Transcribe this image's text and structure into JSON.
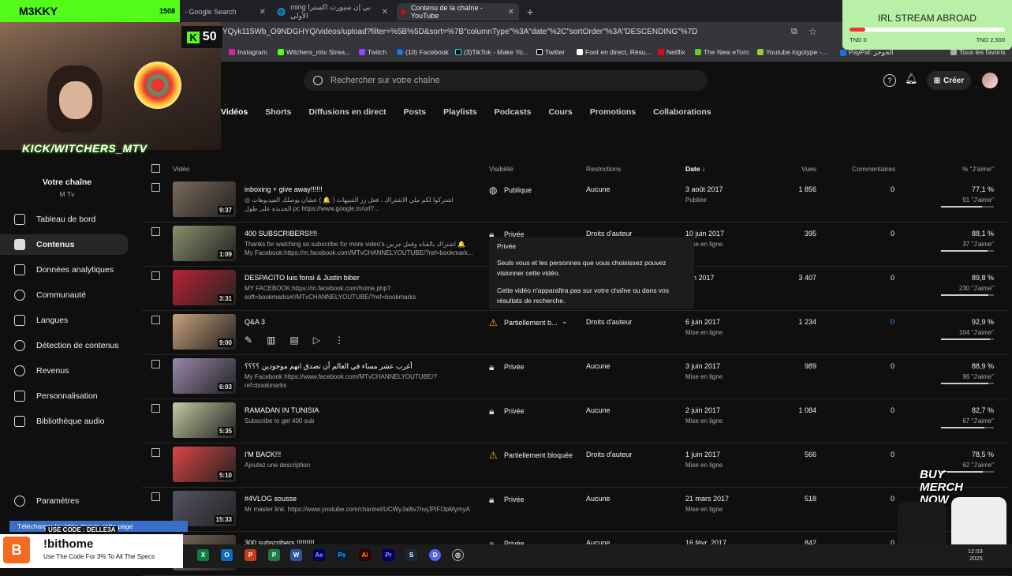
{
  "overlay": {
    "kick_username": "M3KKY",
    "kick_counter": "1508",
    "kick_badge_count": "50",
    "kick_handle": "KICK/WITCHERS_MTV",
    "stream_title": "IRL STREAM ABROAD",
    "stream_min": "TND 0",
    "stream_max": "TND 2,500",
    "stream_progress": 0.1,
    "merch_text": "BUY MERCH NOW",
    "promo_code": "USE CODE : DELLE3A",
    "promo_title": "!bithome",
    "promo_sub": "Use The Code For 3% To All The Specs",
    "download_text": "Télécharger la vidéo depuis cette page"
  },
  "browser": {
    "tabs": [
      {
        "label": "- Google Search"
      },
      {
        "label": "ming بي إن سبورت اكسترا الأولى"
      },
      {
        "label": "Contenu de la chaîne - YouTube"
      }
    ],
    "url": "YQyk115Wb_O9NDGHYQ/videos/upload?filter=%5B%5D&sort=%7B\"columnType\"%3A\"date\"%2C\"sortOrder\"%3A\"DESCENDING\"%7D",
    "bookmarks": [
      "Instagram",
      "Witchers_mtv Strea...",
      "Twitch",
      "(10) Facebook",
      "(3)TikTok - Make Yo...",
      "Twitter",
      "Foot en direct, Résu...",
      "Netflix",
      "The New eToro",
      "Youtube logotype -...",
      "PayPal: الجوجز",
      "Tous les favoris"
    ]
  },
  "header": {
    "search_placeholder": "Rechercher sur votre chaîne",
    "create_label": "Créer"
  },
  "content_tabs": [
    "Vidéos",
    "Shorts",
    "Diffusions en direct",
    "Posts",
    "Playlists",
    "Podcasts",
    "Cours",
    "Promotions",
    "Collaborations"
  ],
  "sidebar": {
    "channel_title": "Votre chaîne",
    "channel_name": "M Tv",
    "items": [
      {
        "label": "Tableau de bord"
      },
      {
        "label": "Contenus"
      },
      {
        "label": "Données analytiques"
      },
      {
        "label": "Communauté"
      },
      {
        "label": "Langues"
      },
      {
        "label": "Détection de contenus"
      },
      {
        "label": "Revenus"
      },
      {
        "label": "Personnalisation"
      },
      {
        "label": "Bibliothèque audio"
      }
    ],
    "settings_label": "Paramètres"
  },
  "table": {
    "headers": {
      "video": "Vidéo",
      "visibility": "Visibilité",
      "restrictions": "Restrictions",
      "date": "Date",
      "views": "Vues",
      "comments": "Commentaires",
      "likes": "% \"J'aime\""
    },
    "rows": [
      {
        "title": "inboxing + give away!!!!!!",
        "desc": "◎ اشتركوا لكم ملي الاشتراك ، فعل زر التنبيهات ( 🔔 ) عشان يوصلك الفيديوهات الجديده على طول pc https://www.google.tn/url?...",
        "duration": "9:37",
        "visibility": "Publique",
        "restriction": "Aucune",
        "date": "3 août 2017",
        "status": "Publiée",
        "views": "1 856",
        "comments": "0",
        "likes": "77,1 %",
        "like_count": "91 \"J'aime\"",
        "like_frac": 0.771
      },
      {
        "title": "400 SUBSCRIBERS!!!!",
        "desc": "Thanks for watching so subscribe for more video's اشتراك بالقناه وفعل جرس 🔔 My Facebook:https://m.facebook.com/MTvCHANNELYOUTUBE/?ref=bookmark...",
        "duration": "1:09",
        "visibility": "Privée",
        "restriction": "Droits d'auteur",
        "date": "10 juin 2017",
        "status": "Mise en ligne",
        "views": "395",
        "comments": "0",
        "likes": "88,1 %",
        "like_count": "37 \"J'aime\"",
        "like_frac": 0.881
      },
      {
        "title": "DESPACITO luis fonsi & Justin biber",
        "desc": "MY FACEBOOK:https://m.facebook.com/home.php?soft=bookmarks#!/MTvCHANNELYOUTUBE/?ref=bookmarks",
        "duration": "3:31",
        "visibility": "",
        "restriction": "",
        "date": "juin 2017",
        "status": "",
        "views": "3 407",
        "comments": "0",
        "likes": "89,8 %",
        "like_count": "230 \"J'aime\"",
        "like_frac": 0.898
      },
      {
        "title": "Q&A 3",
        "desc": "",
        "duration": "9:00",
        "visibility": "Partiellement b...",
        "restriction": "Droits d'auteur",
        "date": "6 juin 2017",
        "status": "Mise en ligne",
        "views": "1 234",
        "comments": "0",
        "likes": "92,9 %",
        "like_count": "104 \"J'aime\"",
        "like_frac": 0.929
      },
      {
        "title": "أغرب عشر مساء في العالم أن تصدق انهم موجودين ؟؟؟؟",
        "desc": "My Facebook https://www.facebook.com/MTvCHANNELYOUTUBE/?ref=bookmarks",
        "duration": "6:03",
        "visibility": "Privée",
        "restriction": "Aucune",
        "date": "3 juin 2017",
        "status": "Mise en ligne",
        "views": "989",
        "comments": "0",
        "likes": "88,9 %",
        "like_count": "96 \"J'aime\"",
        "like_frac": 0.889
      },
      {
        "title": "RAMADAN IN TUNISIA",
        "desc": "Subscribe to get 400 sub",
        "duration": "5:35",
        "visibility": "Privée",
        "restriction": "Aucune",
        "date": "2 juin 2017",
        "status": "Mise en ligne",
        "views": "1 084",
        "comments": "0",
        "likes": "82,7 %",
        "like_count": "67 \"J'aime\"",
        "like_frac": 0.827
      },
      {
        "title": "I'M BACK!!!",
        "desc": "Ajoutez une description",
        "duration": "5:10",
        "visibility": "Partiellement bloquée",
        "restriction": "Droits d'auteur",
        "date": "1 juin 2017",
        "status": "Mise en ligne",
        "views": "566",
        "comments": "0",
        "likes": "78,5 %",
        "like_count": "62 \"J'aime\"",
        "like_frac": 0.785
      },
      {
        "title": "#4VLOG sousse",
        "desc": "Mr master link: https://www.youtube.com/channel/UCWyJal6v7nvjJPiFOpMymyA",
        "duration": "15:33",
        "visibility": "Privée",
        "restriction": "Aucune",
        "date": "21 mars 2017",
        "status": "Mise en ligne",
        "views": "518",
        "comments": "0",
        "likes": "",
        "like_count": "",
        "like_frac": 0
      },
      {
        "title": "300 subscribers !!!!!!!!!",
        "desc": "",
        "duration": "",
        "visibility": "Privée",
        "restriction": "Aucune",
        "date": "16 févr. 2017",
        "status": "",
        "views": "842",
        "comments": "0",
        "likes": "",
        "like_count": "",
        "like_frac": 0
      }
    ]
  },
  "tooltip": {
    "title": "Privée",
    "line1": "Seuls vous et les personnes que vous choisissez pouvez visionner cette vidéo.",
    "line2": "Cette vidéo n'apparaîtra pas sur votre chaîne ou dans vos résultats de recherche."
  },
  "taskbar": {
    "time": "12:03",
    "date": "2025"
  }
}
